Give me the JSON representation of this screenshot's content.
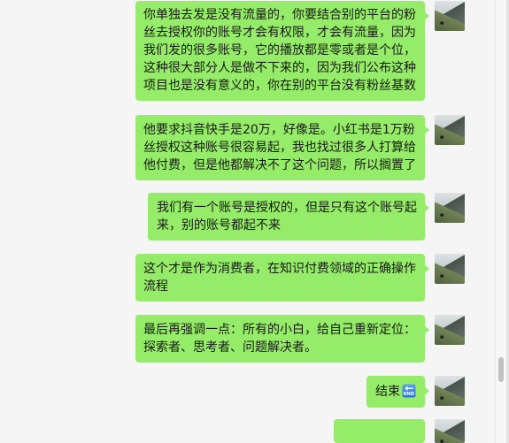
{
  "colors": {
    "background": "#f5f5f5",
    "bubble": "#95ec69",
    "text": "#191919",
    "scroll_thumb": "#c1c1c1"
  },
  "messages": [
    {
      "lines": [
        "你单独去发是没有流量的，你要结合别的平台的粉",
        "丝去授权你的账号才会有权限，才会有流量，因为",
        "我们发的很多账号，它的播放都是零或者是个位，",
        "这种很大部分人是做不下来的，因为我们公布这种",
        "项目也是没有意义的，你在别的平台没有粉丝基数"
      ]
    },
    {
      "lines": [
        "他要求抖音快手是20万，好像是。小红书是1万粉",
        "丝授权这种账号很容易起，我也找过很多人打算给",
        "他付费，但是他都解决不了这个问题，所以搁置了"
      ]
    },
    {
      "lines": [
        "我们有一个账号是授权的，但是只有这个账号起",
        "来，别的账号都起不来"
      ]
    },
    {
      "lines": [
        "这个才是作为消费者，在知识付费领域的正确操作",
        "流程"
      ]
    },
    {
      "lines": [
        "最后再强调一点：所有的小白，给自己重新定位：",
        "探索者、思考者、问题解决者。"
      ]
    },
    {
      "lines": [
        "结束"
      ],
      "icon": "end-icon",
      "icon_label": "END"
    },
    {
      "lines": []
    }
  ],
  "scrollbar": {
    "position": 0.854
  }
}
